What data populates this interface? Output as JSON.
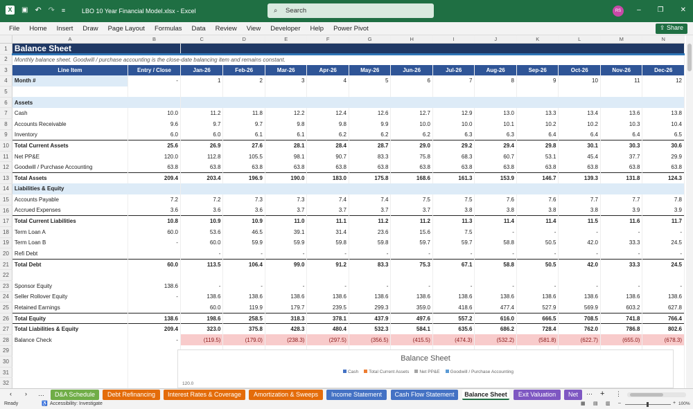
{
  "app": {
    "title": "LBO 10 Year Financial Model.xlsx  -  Excel",
    "search_placeholder": "Search",
    "avatar_initials": "RS",
    "share_label": "Share"
  },
  "menu": [
    "File",
    "Home",
    "Insert",
    "Draw",
    "Page Layout",
    "Formulas",
    "Data",
    "Review",
    "View",
    "Developer",
    "Help",
    "Power Pivot"
  ],
  "columns": [
    "A",
    "B",
    "C",
    "D",
    "E",
    "F",
    "G",
    "H",
    "I",
    "J",
    "K",
    "L",
    "M",
    "N"
  ],
  "rows": [
    {
      "n": "1",
      "cls": "r1",
      "cells": [
        "Balance Sheet"
      ]
    },
    {
      "n": "2",
      "cls": "r2",
      "cells": [
        "Monthly balance sheet. Goodwill / purchase accounting is the close-date balancing item and remains constant."
      ]
    },
    {
      "n": "3",
      "cls": "r3",
      "cells": [
        "Line Item",
        "Entry / Close",
        "Jan-26",
        "Feb-26",
        "Mar-26",
        "Apr-26",
        "May-26",
        "Jun-26",
        "Jul-26",
        "Aug-26",
        "Sep-26",
        "Oct-26",
        "Nov-26",
        "Dec-26"
      ]
    },
    {
      "n": "4",
      "cls": "month",
      "cells": [
        "Month #",
        "-",
        "1",
        "2",
        "3",
        "4",
        "5",
        "6",
        "7",
        "8",
        "9",
        "10",
        "11",
        "12"
      ]
    },
    {
      "n": "5",
      "cls": "blank",
      "cells": []
    },
    {
      "n": "6",
      "cls": "sect",
      "cells": [
        "Assets"
      ]
    },
    {
      "n": "7",
      "cls": "",
      "cells": [
        "Cash",
        "10.0",
        "11.2",
        "11.8",
        "12.2",
        "12.4",
        "12.6",
        "12.7",
        "12.9",
        "13.0",
        "13.3",
        "13.4",
        "13.6",
        "13.8"
      ]
    },
    {
      "n": "8",
      "cls": "",
      "cells": [
        "Accounts Receivable",
        "9.6",
        "9.7",
        "9.7",
        "9.8",
        "9.8",
        "9.9",
        "10.0",
        "10.0",
        "10.1",
        "10.2",
        "10.2",
        "10.3",
        "10.4"
      ]
    },
    {
      "n": "9",
      "cls": "",
      "cells": [
        "Inventory",
        "6.0",
        "6.0",
        "6.1",
        "6.1",
        "6.2",
        "6.2",
        "6.2",
        "6.3",
        "6.3",
        "6.4",
        "6.4",
        "6.4",
        "6.5"
      ]
    },
    {
      "n": "10",
      "cls": "tot",
      "cells": [
        "Total Current Assets",
        "25.6",
        "26.9",
        "27.6",
        "28.1",
        "28.4",
        "28.7",
        "29.0",
        "29.2",
        "29.4",
        "29.8",
        "30.1",
        "30.3",
        "30.6"
      ]
    },
    {
      "n": "11",
      "cls": "",
      "cells": [
        "Net PP&E",
        "120.0",
        "112.8",
        "105.5",
        "98.1",
        "90.7",
        "83.3",
        "75.8",
        "68.3",
        "60.7",
        "53.1",
        "45.4",
        "37.7",
        "29.9"
      ]
    },
    {
      "n": "12",
      "cls": "",
      "cells": [
        "Goodwill / Purchase Accounting",
        "63.8",
        "63.8",
        "63.8",
        "63.8",
        "63.8",
        "63.8",
        "63.8",
        "63.8",
        "63.8",
        "63.8",
        "63.8",
        "63.8",
        "63.8"
      ]
    },
    {
      "n": "13",
      "cls": "tot",
      "cells": [
        "Total Assets",
        "209.4",
        "203.4",
        "196.9",
        "190.0",
        "183.0",
        "175.8",
        "168.6",
        "161.3",
        "153.9",
        "146.7",
        "139.3",
        "131.8",
        "124.3"
      ]
    },
    {
      "n": "14",
      "cls": "sect",
      "cells": [
        "Liabilities & Equity"
      ]
    },
    {
      "n": "15",
      "cls": "",
      "cells": [
        "Accounts Payable",
        "7.2",
        "7.2",
        "7.3",
        "7.3",
        "7.4",
        "7.4",
        "7.5",
        "7.5",
        "7.6",
        "7.6",
        "7.7",
        "7.7",
        "7.8"
      ]
    },
    {
      "n": "16",
      "cls": "",
      "cells": [
        "Accrued Expenses",
        "3.6",
        "3.6",
        "3.6",
        "3.7",
        "3.7",
        "3.7",
        "3.7",
        "3.8",
        "3.8",
        "3.8",
        "3.8",
        "3.9",
        "3.9"
      ]
    },
    {
      "n": "17",
      "cls": "tot",
      "cells": [
        "Total Current Liabilities",
        "10.8",
        "10.9",
        "10.9",
        "11.0",
        "11.1",
        "11.2",
        "11.2",
        "11.3",
        "11.4",
        "11.4",
        "11.5",
        "11.6",
        "11.7"
      ]
    },
    {
      "n": "18",
      "cls": "",
      "cells": [
        "Term Loan A",
        "60.0",
        "53.6",
        "46.5",
        "39.1",
        "31.4",
        "23.6",
        "15.6",
        "7.5",
        "-",
        "-",
        "-",
        "-",
        "-"
      ]
    },
    {
      "n": "19",
      "cls": "",
      "cells": [
        "Term Loan B",
        "-",
        "60.0",
        "59.9",
        "59.9",
        "59.8",
        "59.8",
        "59.7",
        "59.7",
        "58.8",
        "50.5",
        "42.0",
        "33.3",
        "24.5"
      ]
    },
    {
      "n": "20",
      "cls": "",
      "cells": [
        "Refi Debt",
        "",
        "-",
        "-",
        "-",
        "-",
        "-",
        "-",
        "-",
        "-",
        "-",
        "-",
        "-",
        "-"
      ]
    },
    {
      "n": "21",
      "cls": "tot",
      "cells": [
        "Total Debt",
        "60.0",
        "113.5",
        "106.4",
        "99.0",
        "91.2",
        "83.3",
        "75.3",
        "67.1",
        "58.8",
        "50.5",
        "42.0",
        "33.3",
        "24.5"
      ]
    },
    {
      "n": "22",
      "cls": "blank",
      "cells": []
    },
    {
      "n": "23",
      "cls": "",
      "cells": [
        "Sponsor Equity",
        "138.6",
        "-",
        "-",
        "-",
        "-",
        "-",
        "-",
        "-",
        "-",
        "-",
        "-",
        "-",
        "-"
      ]
    },
    {
      "n": "24",
      "cls": "",
      "cells": [
        "Seller Rollover Equity",
        "-",
        "138.6",
        "138.6",
        "138.6",
        "138.6",
        "138.6",
        "138.6",
        "138.6",
        "138.6",
        "138.6",
        "138.6",
        "138.6",
        "138.6"
      ]
    },
    {
      "n": "25",
      "cls": "",
      "cells": [
        "Retained Earnings",
        "",
        "60.0",
        "119.9",
        "179.7",
        "239.5",
        "299.3",
        "359.0",
        "418.6",
        "477.4",
        "527.9",
        "569.9",
        "603.2",
        "627.8"
      ]
    },
    {
      "n": "26",
      "cls": "tot",
      "cells": [
        "Total Equity",
        "138.6",
        "198.6",
        "258.5",
        "318.3",
        "378.1",
        "437.9",
        "497.6",
        "557.2",
        "616.0",
        "666.5",
        "708.5",
        "741.8",
        "766.4"
      ]
    },
    {
      "n": "27",
      "cls": "tot",
      "cells": [
        "Total Liabilities & Equity",
        "209.4",
        "323.0",
        "375.8",
        "428.3",
        "480.4",
        "532.3",
        "584.1",
        "635.6",
        "686.2",
        "728.4",
        "762.0",
        "786.8",
        "802.6"
      ]
    },
    {
      "n": "28",
      "cls": "bal",
      "cells": [
        "Balance Check",
        "-",
        "(119.5)",
        "(179.0)",
        "(238.3)",
        "(297.5)",
        "(356.5)",
        "(415.5)",
        "(474.3)",
        "(532.2)",
        "(581.8)",
        "(622.7)",
        "(655.0)",
        "(678.3)"
      ]
    },
    {
      "n": "29",
      "cls": "blank",
      "cells": []
    },
    {
      "n": "30",
      "cls": "blank",
      "cells": []
    },
    {
      "n": "31",
      "cls": "blank",
      "cells": []
    },
    {
      "n": "32",
      "cls": "blank",
      "cells": []
    }
  ],
  "chart": {
    "title": "Balance Sheet",
    "legend": [
      {
        "label": "Cash",
        "color": "#4472c4"
      },
      {
        "label": "Total Current Assets",
        "color": "#ed7d31"
      },
      {
        "label": "Net PP&E",
        "color": "#a5a5a5"
      },
      {
        "label": "Goodwill / Purchase Accounting",
        "color": "#5b9bd5"
      }
    ],
    "ytick": "120.0"
  },
  "tabs": [
    {
      "label": "D&A Schedule",
      "bg": "#70ad47",
      "fg": "#fff"
    },
    {
      "label": "Debt Refinancing",
      "bg": "#e46c0a",
      "fg": "#fff"
    },
    {
      "label": "Interest Rates & Coverage",
      "bg": "#e46c0a",
      "fg": "#fff"
    },
    {
      "label": "Amortization & Sweeps",
      "bg": "#e46c0a",
      "fg": "#fff"
    },
    {
      "label": "Income Statement",
      "bg": "#4472c4",
      "fg": "#fff"
    },
    {
      "label": "Cash Flow Statement",
      "bg": "#4472c4",
      "fg": "#fff"
    },
    {
      "label": "Balance Sheet",
      "bg": "#ffffff",
      "fg": "#222"
    },
    {
      "label": "Exit Valuation",
      "bg": "#7e57c2",
      "fg": "#fff"
    },
    {
      "label": "Net",
      "bg": "#7e57c2",
      "fg": "#fff"
    }
  ],
  "status": {
    "ready": "Ready",
    "accessibility": "Accessibility: Investigate",
    "zoom": "100%"
  }
}
